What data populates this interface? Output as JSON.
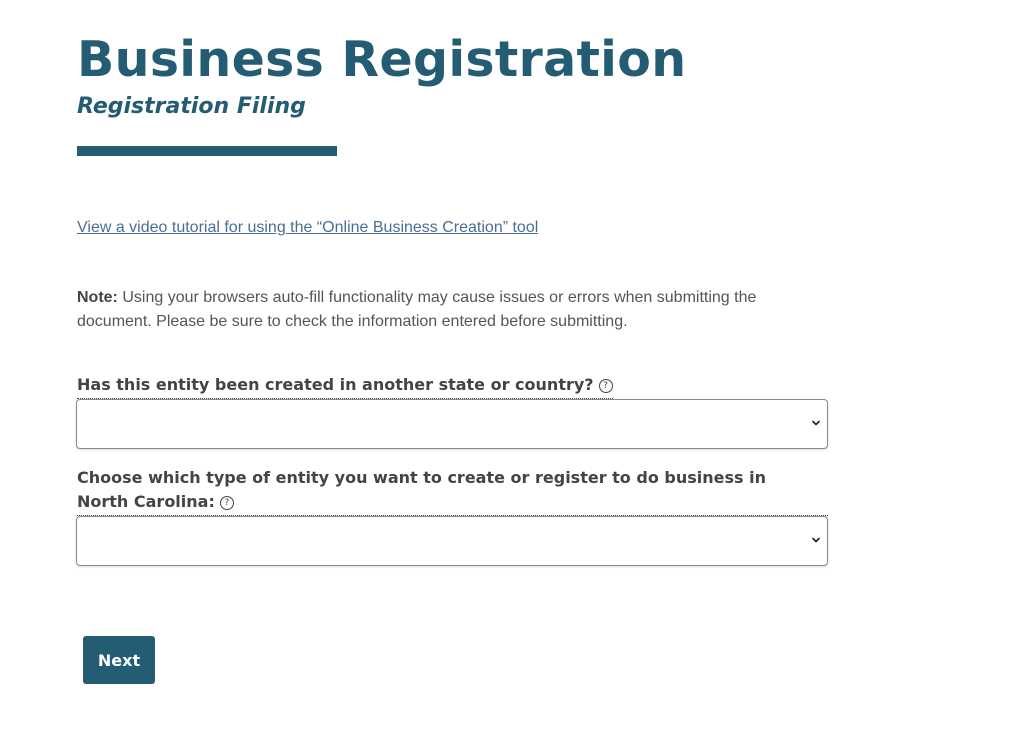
{
  "header": {
    "title": "Business Registration",
    "subtitle": "Registration Filing"
  },
  "tutorial_link": "View a video tutorial for using the “Online Business Creation” tool",
  "note": {
    "label": "Note:",
    "text": " Using your browsers auto-fill functionality may cause issues or errors when submitting the document. Please be sure to check the information entered before submitting."
  },
  "form": {
    "question_1": {
      "label": "Has this entity been created in another state or country?",
      "selected_value": ""
    },
    "question_2": {
      "label": "Choose which type of entity you want to create or register to do business in North Carolina:",
      "selected_value": ""
    },
    "next_label": "Next"
  },
  "icons": {
    "help": "help-circle-icon",
    "dropdown": "chevron-down-icon"
  },
  "colors": {
    "brand": "#245d73",
    "link": "#4a6f92",
    "text": "#444444"
  }
}
